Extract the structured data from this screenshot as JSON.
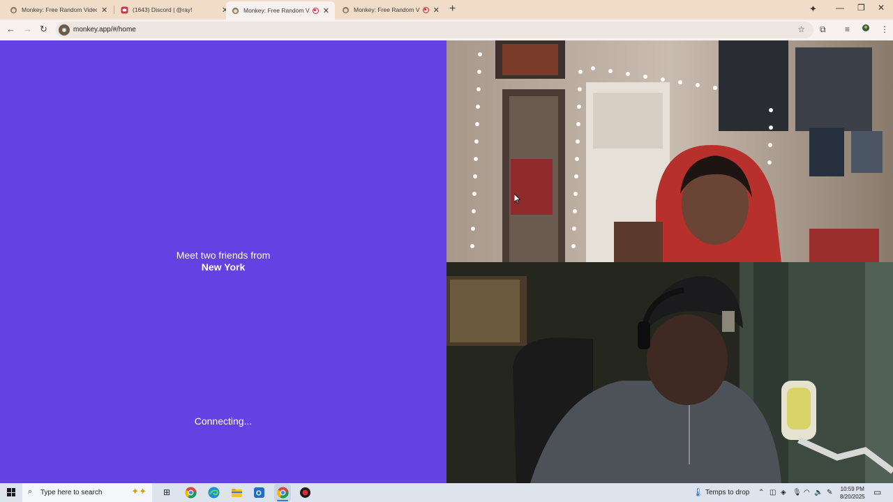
{
  "browser": {
    "tabs": [
      {
        "title": "Monkey: Free Random Video Ch",
        "icon": "monkey-icon",
        "recording": false,
        "active": false
      },
      {
        "title": "(1643) Discord | @ray!",
        "icon": "discord-icon",
        "recording": false,
        "active": false
      },
      {
        "title": "Monkey: Free Random Vide",
        "icon": "monkey-icon",
        "recording": true,
        "active": true
      },
      {
        "title": "Monkey: Free Random Vide",
        "icon": "monkey-icon",
        "recording": true,
        "active": false
      }
    ],
    "url": "monkey.app/#/home"
  },
  "page": {
    "meet_line": "Meet two friends from",
    "location": "New York",
    "status": "Connecting...",
    "accent_color": "#6441e2"
  },
  "taskbar": {
    "search_placeholder": "Type here to search",
    "weather": "Temps to drop",
    "time": "10:59 PM",
    "date": "8/20/2025"
  }
}
